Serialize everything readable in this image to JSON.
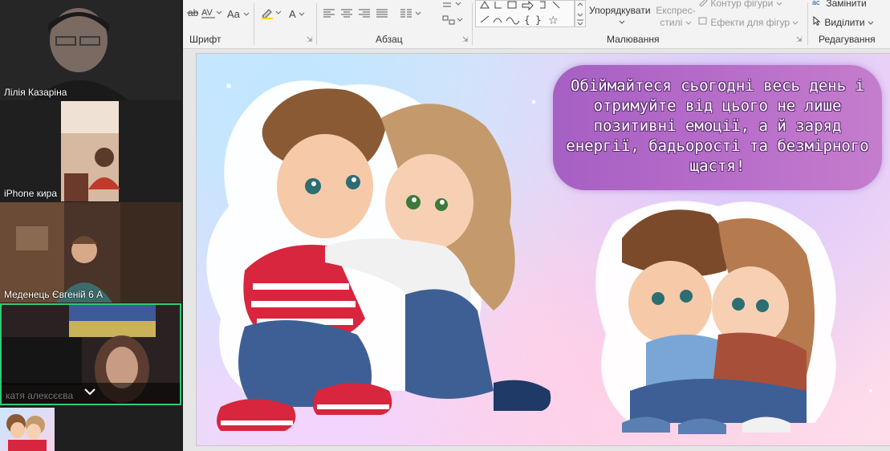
{
  "ribbon": {
    "groups": {
      "font": "Шрифт",
      "paragraph": "Абзац",
      "drawing": "Малювання",
      "editing": "Редагування"
    },
    "font_tools": [
      "Aa",
      "A"
    ],
    "drawing": {
      "arrange_label": "Упорядкувати",
      "quick_styles_label_1": "Експрес-",
      "quick_styles_label_2": "стилі",
      "shape_outline_label": "Контур фігури",
      "shape_effects_label": "Ефекти для фігур"
    },
    "editing": {
      "replace_label": "Замінити",
      "select_label": "Виділити"
    }
  },
  "slide": {
    "bubble_text": "Обіймайтеся сьогодні весь день і отримуйте від цього не лише позитивні емоції, а й заряд енергії, бадьорості та безмірного щастя!"
  },
  "participants": [
    {
      "name": "Лілія Казаріна"
    },
    {
      "name": "iPhone кира"
    },
    {
      "name": "Меденець Євгеній 6 А"
    },
    {
      "name": "катя алексєєва"
    }
  ],
  "colors": {
    "active_speaker_border": "#2ecc71",
    "bubble": "#a65fc3"
  }
}
